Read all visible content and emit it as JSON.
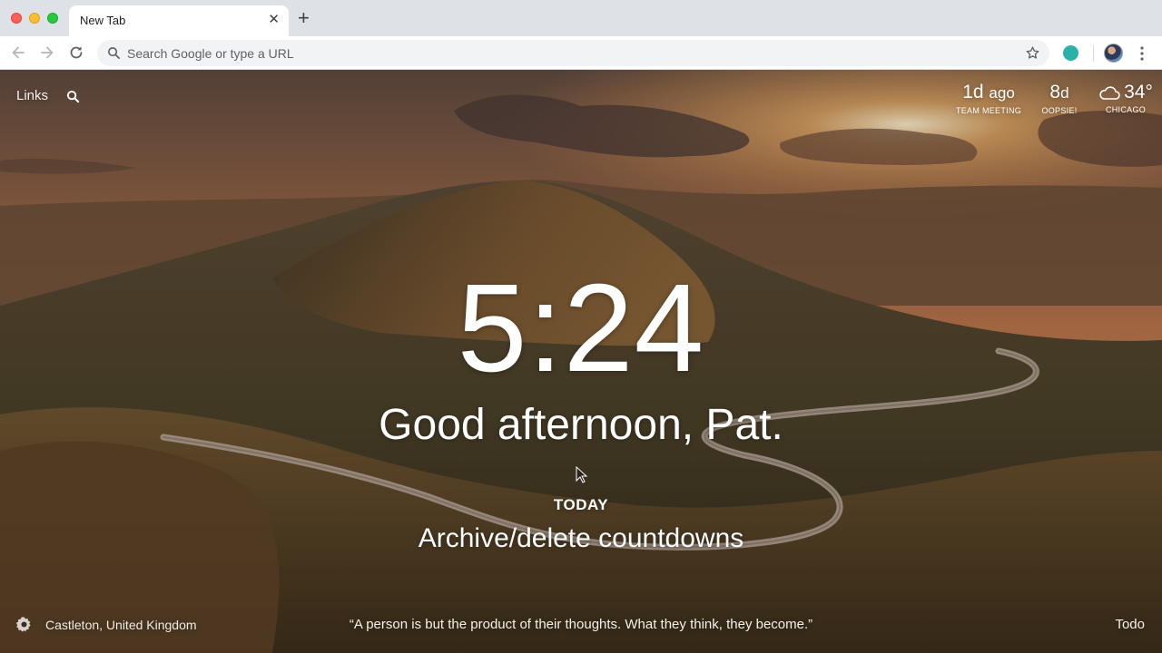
{
  "browser": {
    "tab_title": "New Tab",
    "tab_close_icon": "close-icon",
    "new_tab_icon": "plus-icon",
    "omnibox_placeholder": "Search Google or type a URL",
    "extension_color": "#2ab1a8"
  },
  "top_left": {
    "links_label": "Links",
    "search_icon": "search-icon"
  },
  "widgets": {
    "meeting": {
      "value": "1d",
      "unit": "ago",
      "label": "TEAM MEETING"
    },
    "oops": {
      "value": "8",
      "unit": "d",
      "label": "OOPSIE!"
    },
    "weather": {
      "icon": "cloud-icon",
      "temperature": "34°",
      "label": "CHICAGO"
    }
  },
  "center": {
    "clock": "5:24",
    "greeting": "Good afternoon, Pat.",
    "today_label": "TODAY",
    "focus": "Archive/delete countdowns"
  },
  "footer": {
    "settings_icon": "gear-icon",
    "location": "Castleton, United Kingdom",
    "quote": "“A person is but the product of their thoughts. What they think, they become.”",
    "todo_label": "Todo"
  }
}
